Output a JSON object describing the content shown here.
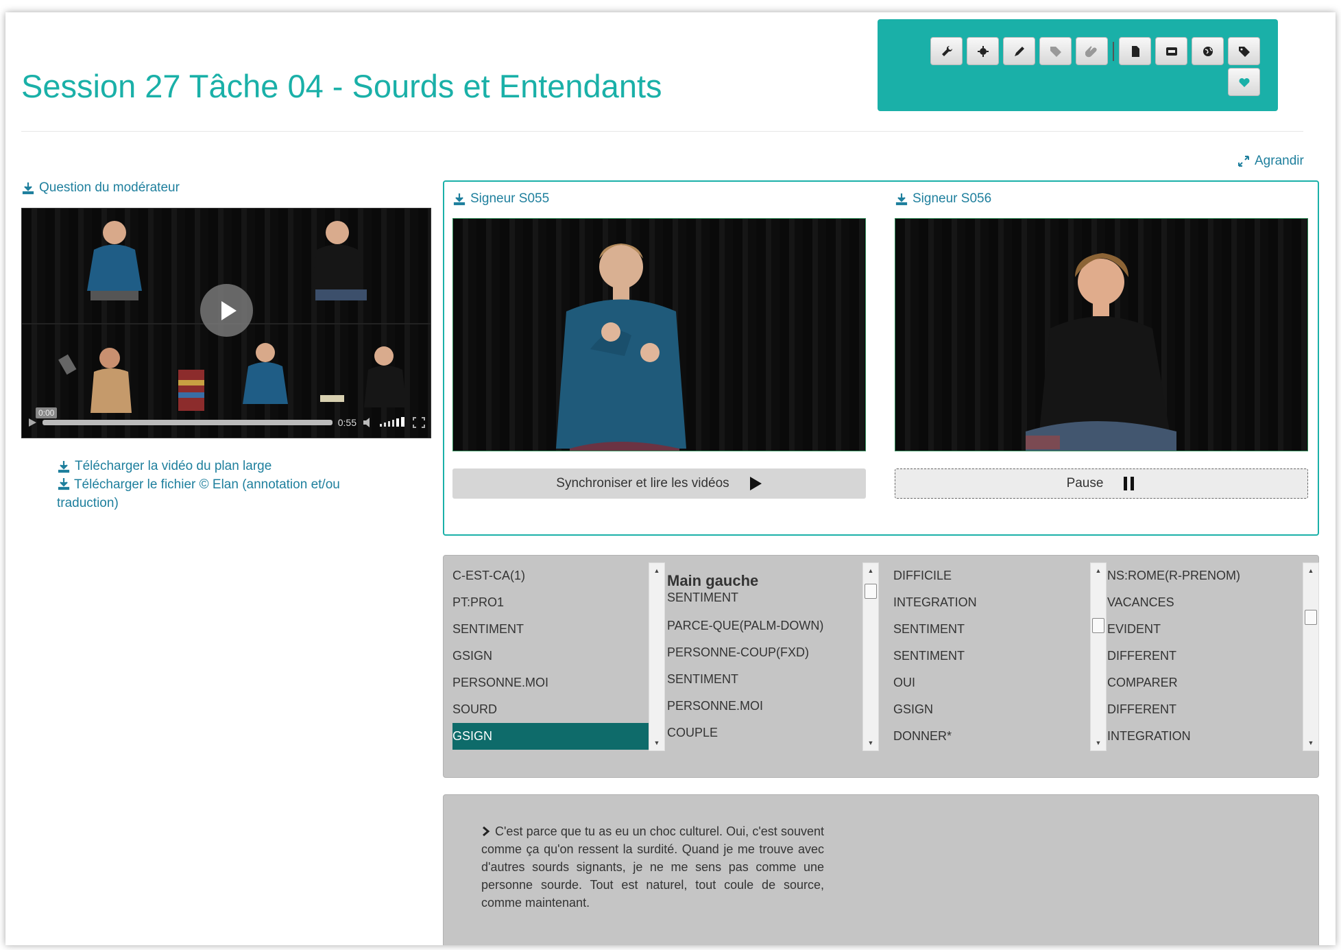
{
  "page": {
    "title": "Session 27 Tâche 04 - Sourds et Entendants",
    "agrandir_label": "Agrandir"
  },
  "toolbar": {
    "buttons": [
      "wrench-icon",
      "circle-icon",
      "pencil-icon",
      "tag-icon",
      "paperclip-icon",
      "file-icon",
      "subtitles-icon",
      "globe-icon",
      "tags-icon",
      "heart-icon"
    ]
  },
  "moderator": {
    "label": "Question du modérateur",
    "time_current": "0:00",
    "time_total": "0:55",
    "downloads": {
      "video": "Télécharger la vidéo du plan large",
      "elan": "Télécharger le fichier © Elan (annotation et/ou traduction)"
    }
  },
  "signers": [
    {
      "label": "Signeur S055",
      "button": "Synchroniser et lire les vidéos"
    },
    {
      "label": "Signeur S056",
      "button": "Pause"
    }
  ],
  "gloss_columns": [
    {
      "items": [
        "C-EST-CA(1)",
        "PT:PRO1",
        "SENTIMENT",
        "GSIGN",
        "PERSONNE.MOI",
        "SOURD",
        "GSIGN"
      ],
      "selected_index": 6
    },
    {
      "title": "Main gauche",
      "items": [
        "SENTIMENT",
        "PARCE-QUE(PALM-DOWN)",
        "PERSONNE-COUP(FXD)",
        "SENTIMENT",
        "PERSONNE.MOI",
        "COUPLE"
      ]
    },
    {
      "items": [
        "DIFFICILE",
        "INTEGRATION",
        "SENTIMENT",
        "SENTIMENT",
        "OUI",
        "GSIGN",
        "DONNER*"
      ]
    },
    {
      "items": [
        "NS:ROME(R-PRENOM)",
        "VACANCES",
        "EVIDENT",
        "DIFFERENT",
        "COMPARER",
        "DIFFERENT",
        "INTEGRATION"
      ]
    }
  ],
  "translation": {
    "text": "C'est parce que tu as eu un choc culturel. Oui, c'est souvent comme ça qu'on ressent la surdité. Quand je me trouve avec d'autres sourds signants, je ne me sens pas comme une personne sourde. Tout est naturel, tout coule de source, comme maintenant."
  },
  "colors": {
    "accent": "#1ab0a8",
    "link": "#1e7f9d",
    "selected": "#0e6b6a",
    "panel_grey": "#c5c5c5"
  }
}
